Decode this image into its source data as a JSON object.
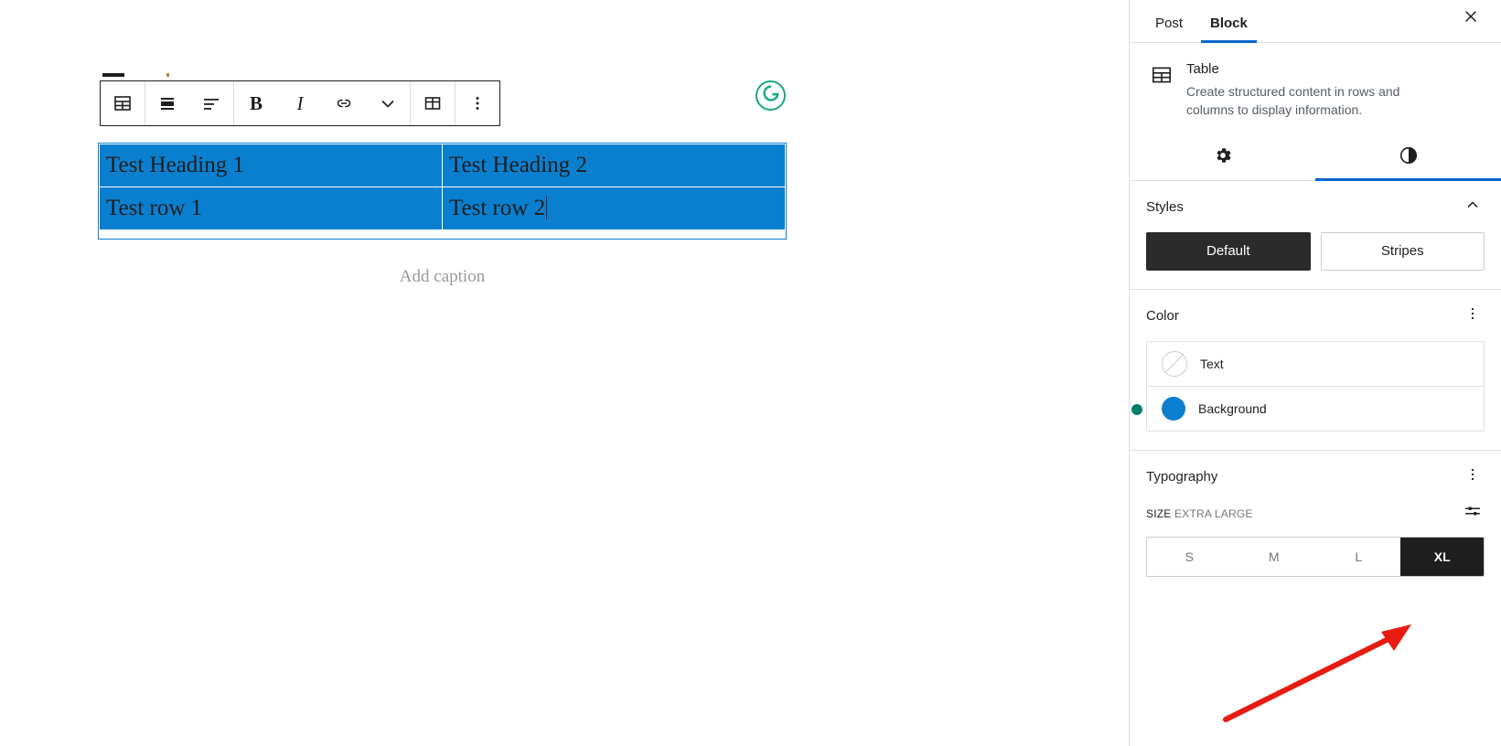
{
  "editor": {
    "toolbar": {
      "buttons": [
        {
          "name": "block-type-table",
          "icon": "table-icon",
          "label": "Table"
        },
        {
          "name": "align-block",
          "icon": "align-block-icon",
          "label": "Change block alignment"
        },
        {
          "name": "align-text",
          "icon": "align-text-icon",
          "label": "Align text"
        },
        {
          "name": "bold",
          "icon": "bold-icon",
          "label": "B"
        },
        {
          "name": "italic",
          "icon": "italic-icon",
          "label": "I"
        },
        {
          "name": "link",
          "icon": "link-icon",
          "label": "Link"
        },
        {
          "name": "more-rich-text",
          "icon": "chevron-down-icon",
          "label": "More"
        },
        {
          "name": "edit-table",
          "icon": "table-edit-icon",
          "label": "Edit table"
        },
        {
          "name": "block-options",
          "icon": "three-dots-vertical-icon",
          "label": "Options"
        }
      ]
    },
    "table": {
      "headers": [
        "Test Heading 1",
        "Test Heading 2"
      ],
      "rows": [
        [
          "Test row 1",
          "Test row 2"
        ]
      ],
      "background_color": "#0b7fcf",
      "text_color": "#1e1e1e",
      "caret_cell": "Test row 2"
    },
    "caption_placeholder": "Add caption",
    "grammarly_badge": {
      "icon": "grammarly-icon",
      "color": "#15a87f"
    },
    "status_dot": {
      "name": "teal-status-dot",
      "color": "#00806b"
    }
  },
  "sidebar": {
    "tabs": [
      {
        "label": "Post",
        "active": false
      },
      {
        "label": "Block",
        "active": true
      }
    ],
    "close_icon": "close-icon",
    "block_card": {
      "icon": "table-icon",
      "title": "Table",
      "description": "Create structured content in rows and columns to display information."
    },
    "panel_tabs": [
      {
        "name": "settings",
        "icon": "gear-icon",
        "active": false
      },
      {
        "name": "styles",
        "icon": "contrast-icon",
        "active": true
      }
    ],
    "styles_section": {
      "title": "Styles",
      "collapse_icon": "chevron-up-icon",
      "options": [
        {
          "label": "Default",
          "selected": true
        },
        {
          "label": "Stripes",
          "selected": false
        }
      ]
    },
    "color_section": {
      "title": "Color",
      "menu_icon": "three-dots-vertical-icon",
      "items": [
        {
          "label": "Text",
          "swatch": "none"
        },
        {
          "label": "Background",
          "swatch": "#0b7fcf"
        }
      ]
    },
    "typography_section": {
      "title": "Typography",
      "menu_icon": "three-dots-vertical-icon",
      "size_key": "SIZE",
      "size_value": "EXTRA LARGE",
      "settings_icon": "sliders-icon",
      "sizes": [
        {
          "label": "S",
          "selected": false
        },
        {
          "label": "M",
          "selected": false
        },
        {
          "label": "L",
          "selected": false
        },
        {
          "label": "XL",
          "selected": true
        }
      ]
    }
  },
  "annotation": {
    "arrow_color": "#e81b10"
  }
}
